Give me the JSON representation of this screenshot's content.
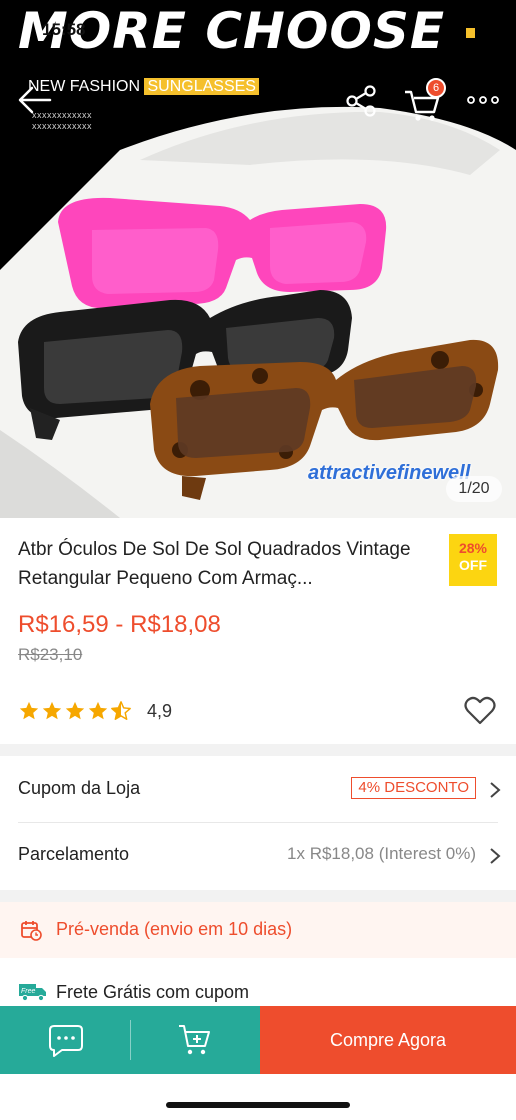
{
  "status_bar": {
    "time": "15:58"
  },
  "hero": {
    "headline": "MORE CHOOSE",
    "subtitle_prefix": "NEW FASHION",
    "subtitle_highlight": "SUNGLASSES",
    "subline_1": "xxxxxxxxxxxx",
    "subline_2": "xxxxxxxxxxxx",
    "watermark": "attractivefinewell",
    "image_counter": "1/20"
  },
  "nav": {
    "back_icon": "back-arrow-icon",
    "share_icon": "share-icon",
    "cart_icon": "cart-icon",
    "cart_count": "6",
    "more_icon": "more-dots-icon"
  },
  "product": {
    "title": "Atbr Óculos De Sol De Sol Quadrados Vintage Retangular Pequeno Com Armaç...",
    "discount_pct": "28%",
    "discount_label": "OFF",
    "price_range": "R$16,59 - R$18,08",
    "original_price": "R$23,10",
    "rating_value": "4,9",
    "rating_stars": 4.5
  },
  "rows": {
    "coupon_label": "Cupom da Loja",
    "coupon_value": "4% DESCONTO",
    "installment_label": "Parcelamento",
    "installment_value": "1x R$18,08 (Interest 0%)"
  },
  "preorder": {
    "text": "Pré-venda (envio em 10 dias)"
  },
  "shipping": {
    "text": "Frete Grátis com cupom",
    "icon_label": "Free"
  },
  "bottom_bar": {
    "buy_label": "Compre Agora"
  },
  "colors": {
    "accent": "#ee4d2d",
    "teal": "#26aa99",
    "badge_yellow": "#fcd511",
    "star": "#f6a700"
  }
}
